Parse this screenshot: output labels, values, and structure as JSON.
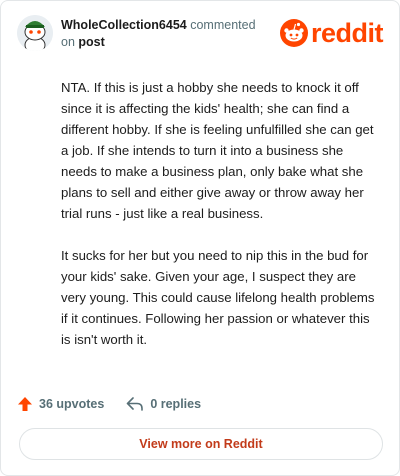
{
  "comment": {
    "author": "WholeCollection6454",
    "verb": "commented",
    "on": "on",
    "post_link": "post",
    "paragraphs": [
      "NTA. If this is just a hobby she needs to knock it off since it is affecting the kids' health; she can find a different hobby. If she is feeling unfulfilled she can get a job. If she intends to turn it into a business she needs to make a business plan, only bake what she plans to sell and either give away or throw away her trial runs - just like a real business.",
      "It sucks for her but you need to nip this in the bud for your kids' sake. Given your age, I suspect they are very young. This could cause lifelong health problems if it continues. Following her passion or whatever this is isn't worth it."
    ],
    "upvotes": "36 upvotes",
    "replies": "0 replies"
  },
  "brand": {
    "name": "reddit",
    "color": "#ff4500"
  },
  "footer": {
    "view_more_label": "View more on Reddit"
  },
  "icons": {
    "avatar": "snoo-avatar-icon",
    "logo": "reddit-logo-icon",
    "upvote": "upvote-arrow-icon",
    "reply": "reply-arrow-icon"
  }
}
